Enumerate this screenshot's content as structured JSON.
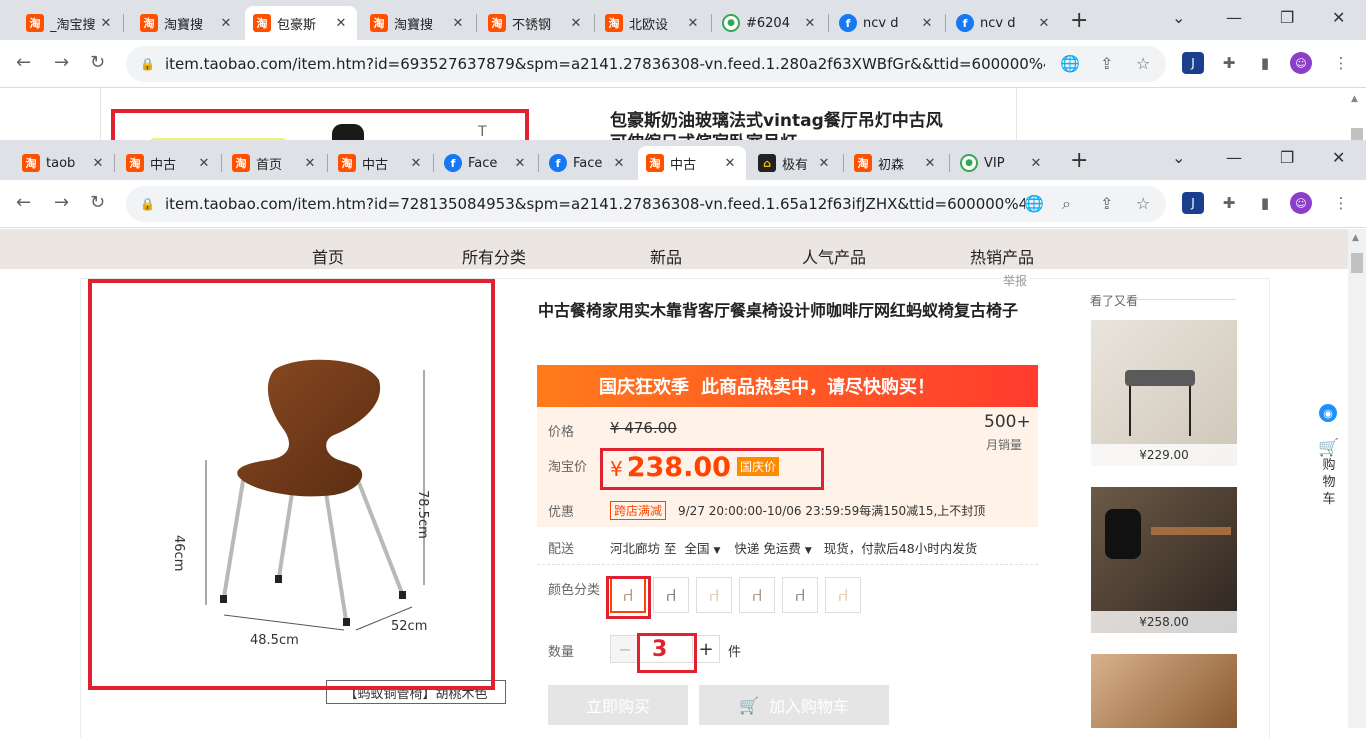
{
  "back_window": {
    "tabs": [
      "_淘宝搜",
      "淘寶搜",
      "包豪斯",
      "淘寶搜",
      "不锈钢",
      "北欧设",
      "#6204",
      "ncv d",
      "ncv d"
    ],
    "url": "item.taobao.com/item.htm?id=693527637879&spm=a2141.27836308-vn.feed.1.280a2f63XWBfGr&&ttid=600000%40ta...",
    "title_line1": "包豪斯奶油玻璃法式vintag餐厅吊灯中古风",
    "title_line2": "可伸缩日式侘寂卧室吊灯",
    "image_mark": "T"
  },
  "front_window": {
    "tabs": [
      "taob",
      "中古",
      "首页",
      "中古",
      "Face",
      "Face",
      "中古",
      "极有",
      "初森",
      "VIP"
    ],
    "url": "item.taobao.com/item.htm?id=728135084953&spm=a2141.27836308-vn.feed.1.65a12f63ifJZHX&ttid=600000%40t..."
  },
  "shop_nav": [
    "首页",
    "所有分类",
    "新品",
    "人气产品",
    "热销产品"
  ],
  "report": "举报",
  "product": {
    "title": "中古餐椅家用实木靠背客厅餐桌椅设计师咖啡厅网红蚂蚁椅复古椅子",
    "image_dims": {
      "height": "78.5cm",
      "seat": "46cm",
      "width": "48.5cm",
      "depth": "52cm"
    },
    "image_caption": "【蚂蚁铜管椅】胡桃木色",
    "banner_left": "国庆狂欢季",
    "banner_right": "此商品热卖中，请尽快购买！",
    "price_label": "价格",
    "original_price": "¥ 476.00",
    "monthly_sales": "500+",
    "monthly_sales_label": "月销量",
    "taobao_price_label": "淘宝价",
    "price_symbol": "¥",
    "price": "238.00",
    "price_tag": "国庆价",
    "discount_label": "优惠",
    "discount_tag": "跨店满减",
    "discount_text": "9/27 20:00:00-10/06 23:59:59每满150减15,上不封顶",
    "delivery_label": "配送",
    "delivery_from": "河北廊坊 至",
    "delivery_to": "全国",
    "delivery_method": "快递 免运费",
    "delivery_note": "现货，付款后48小时内发货",
    "color_label": "颜色分类",
    "qty_label": "数量",
    "qty_minus": "−",
    "qty_value": "3",
    "qty_plus": "+",
    "qty_unit": "件",
    "buy_now": "立即购买",
    "add_cart": "加入购物车",
    "cart_icon": "🛒"
  },
  "related": {
    "title": "看了又看",
    "items": [
      {
        "price": "¥229.00"
      },
      {
        "price": "¥258.00"
      }
    ]
  },
  "side_cart": {
    "line1": "购",
    "line2": "物",
    "line3": "车"
  },
  "colors": {
    "accent": "#ff5000",
    "red_box": "#e02130",
    "price": "#ff4400"
  }
}
